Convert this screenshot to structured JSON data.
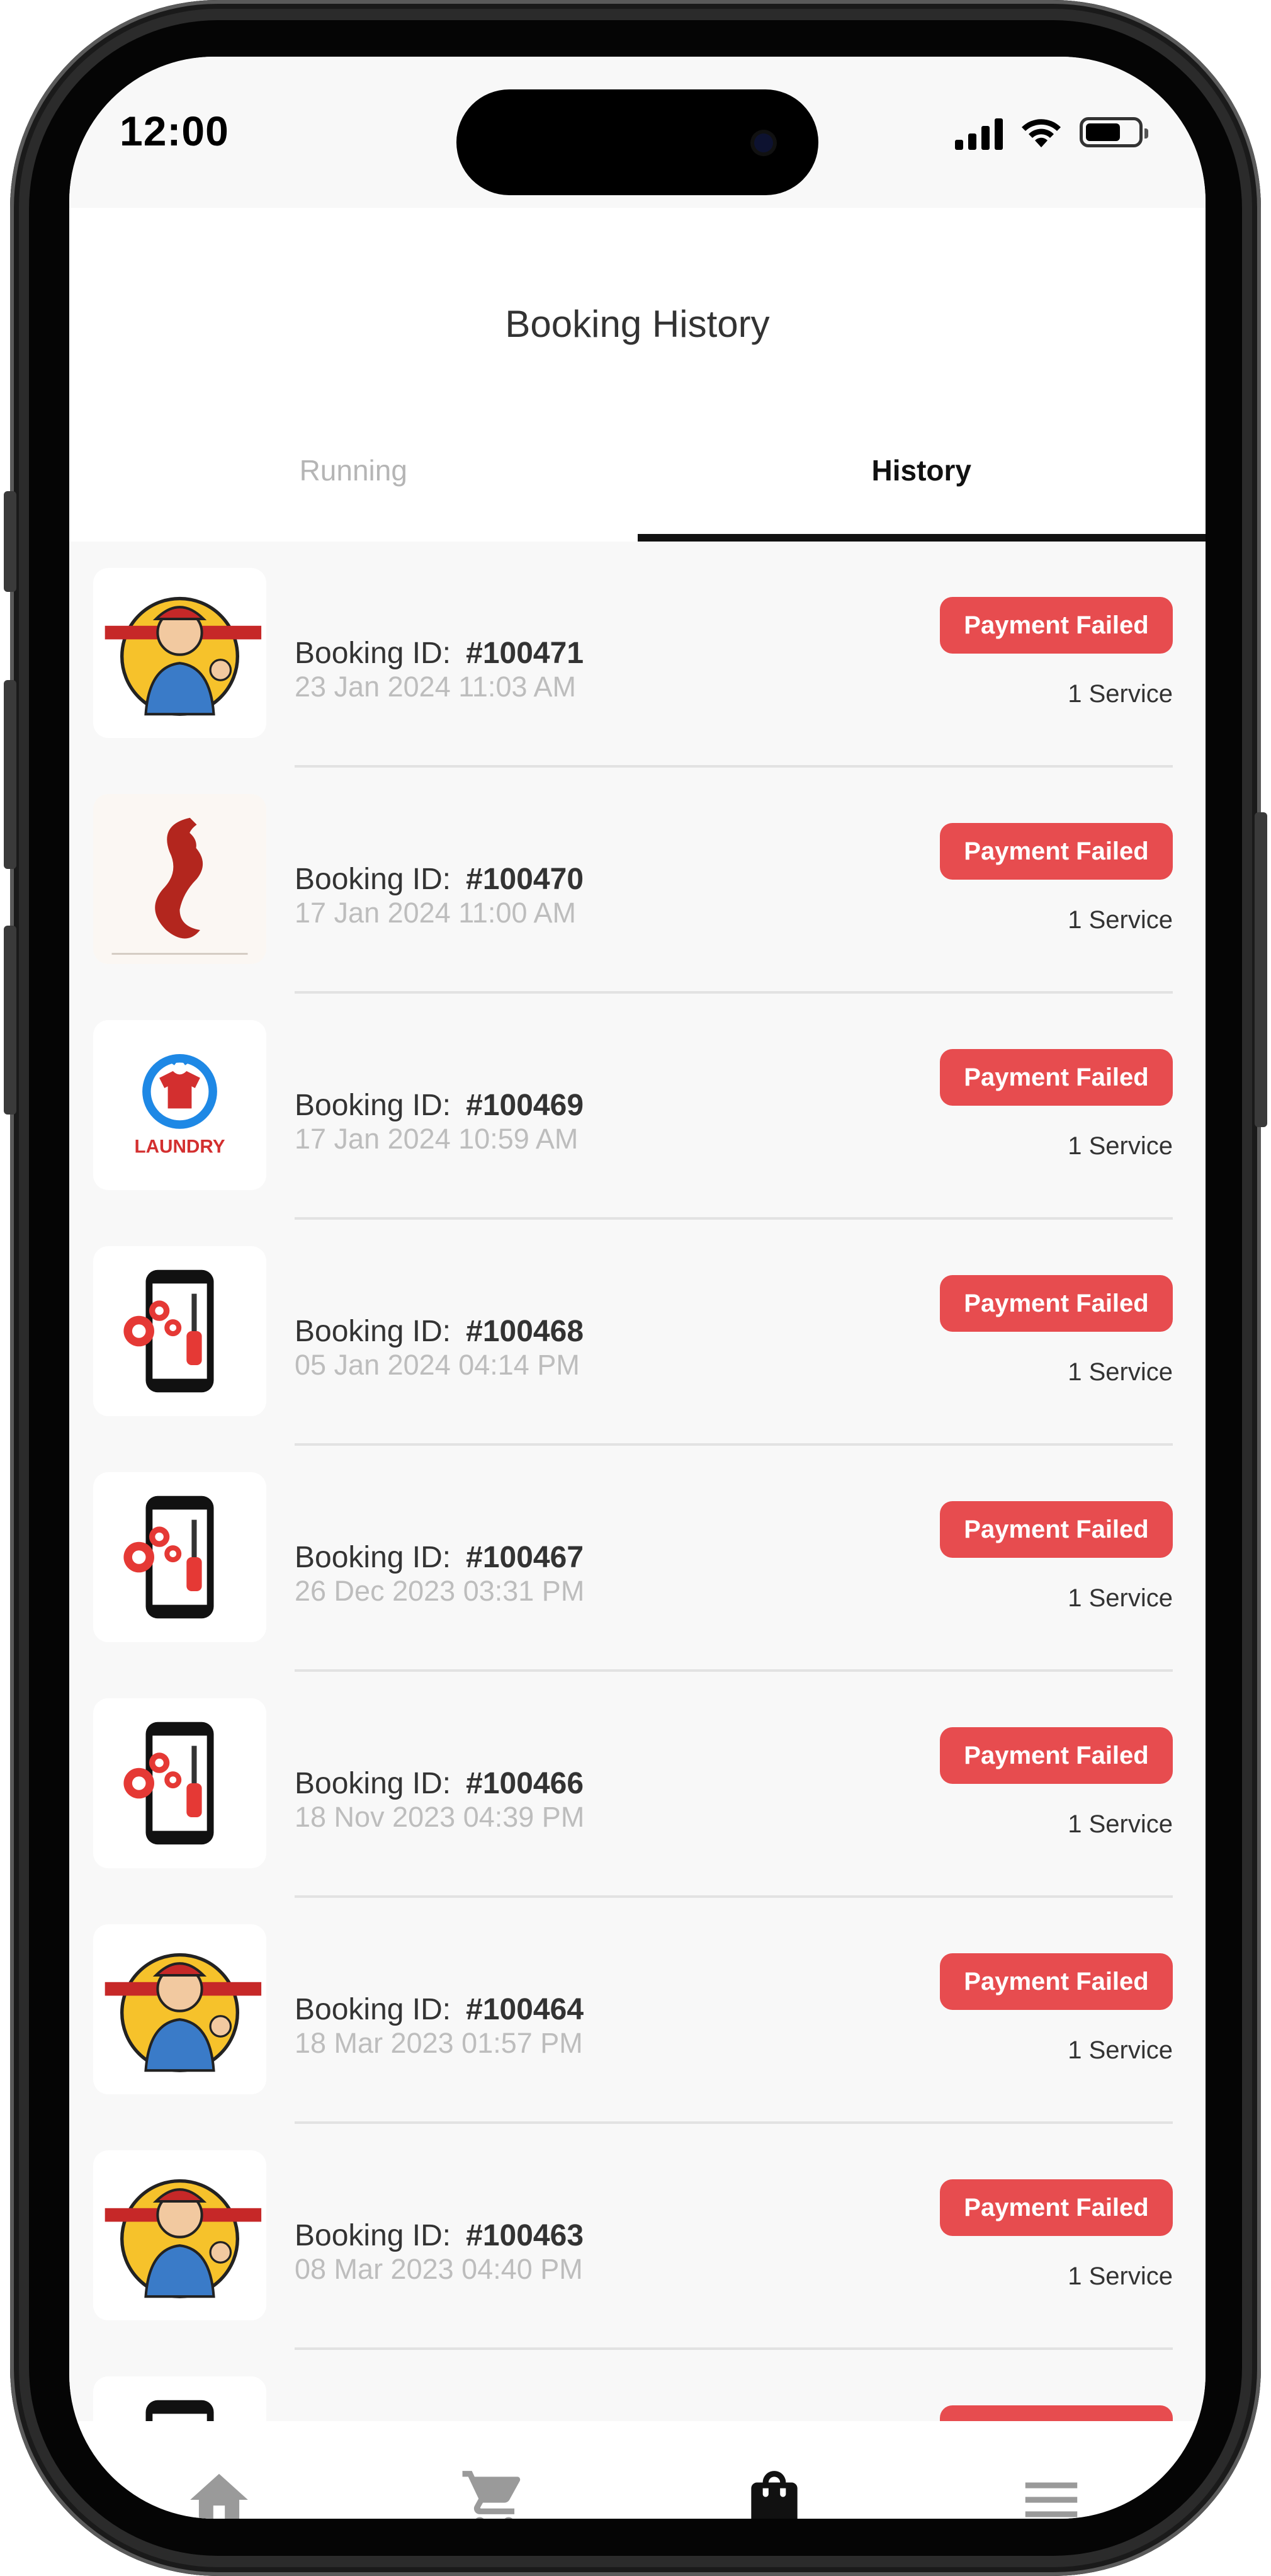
{
  "status_bar": {
    "time": "12:00"
  },
  "header": {
    "title": "Booking History"
  },
  "tabs": [
    {
      "label": "Running"
    },
    {
      "label": "History"
    }
  ],
  "bookings": [
    {
      "id_label": "Booking ID:",
      "id": "#100471",
      "datetime": "23 Jan 2024  11:03 AM",
      "status": "Payment Failed",
      "services": "1 Service",
      "icon": "plumber-mascot-icon"
    },
    {
      "id_label": "Booking ID:",
      "id": "#100470",
      "datetime": "17 Jan 2024  11:00 AM",
      "status": "Payment Failed",
      "services": "1 Service",
      "icon": "salon-logo-icon"
    },
    {
      "id_label": "Booking ID:",
      "id": "#100469",
      "datetime": "17 Jan 2024  10:59 AM",
      "status": "Payment Failed",
      "services": "1 Service",
      "icon": "laundry-logo-icon"
    },
    {
      "id_label": "Booking ID:",
      "id": "#100468",
      "datetime": "05 Jan 2024  04:14 PM",
      "status": "Payment Failed",
      "services": "1 Service",
      "icon": "phone-repair-icon"
    },
    {
      "id_label": "Booking ID:",
      "id": "#100467",
      "datetime": "26 Dec 2023  03:31 PM",
      "status": "Payment Failed",
      "services": "1 Service",
      "icon": "phone-repair-icon"
    },
    {
      "id_label": "Booking ID:",
      "id": "#100466",
      "datetime": "18 Nov 2023  04:39 PM",
      "status": "Payment Failed",
      "services": "1 Service",
      "icon": "phone-repair-icon"
    },
    {
      "id_label": "Booking ID:",
      "id": "#100464",
      "datetime": "18 Mar 2023  01:57 PM",
      "status": "Payment Failed",
      "services": "1 Service",
      "icon": "plumber-mascot-icon"
    },
    {
      "id_label": "Booking ID:",
      "id": "#100463",
      "datetime": "08 Mar 2023  04:40 PM",
      "status": "Payment Failed",
      "services": "1 Service",
      "icon": "plumber-mascot-icon"
    }
  ],
  "bottom_nav": [
    {
      "name": "home-icon",
      "active": false
    },
    {
      "name": "cart-icon",
      "active": false
    },
    {
      "name": "bag-icon",
      "active": true
    },
    {
      "name": "menu-icon",
      "active": false
    }
  ],
  "colors": {
    "accent_badge": "#e74c4f",
    "active_tab": "#111111",
    "inactive_tab": "#b5b5b5",
    "nav_inactive": "#9a9a9a",
    "nav_active": "#111111"
  }
}
